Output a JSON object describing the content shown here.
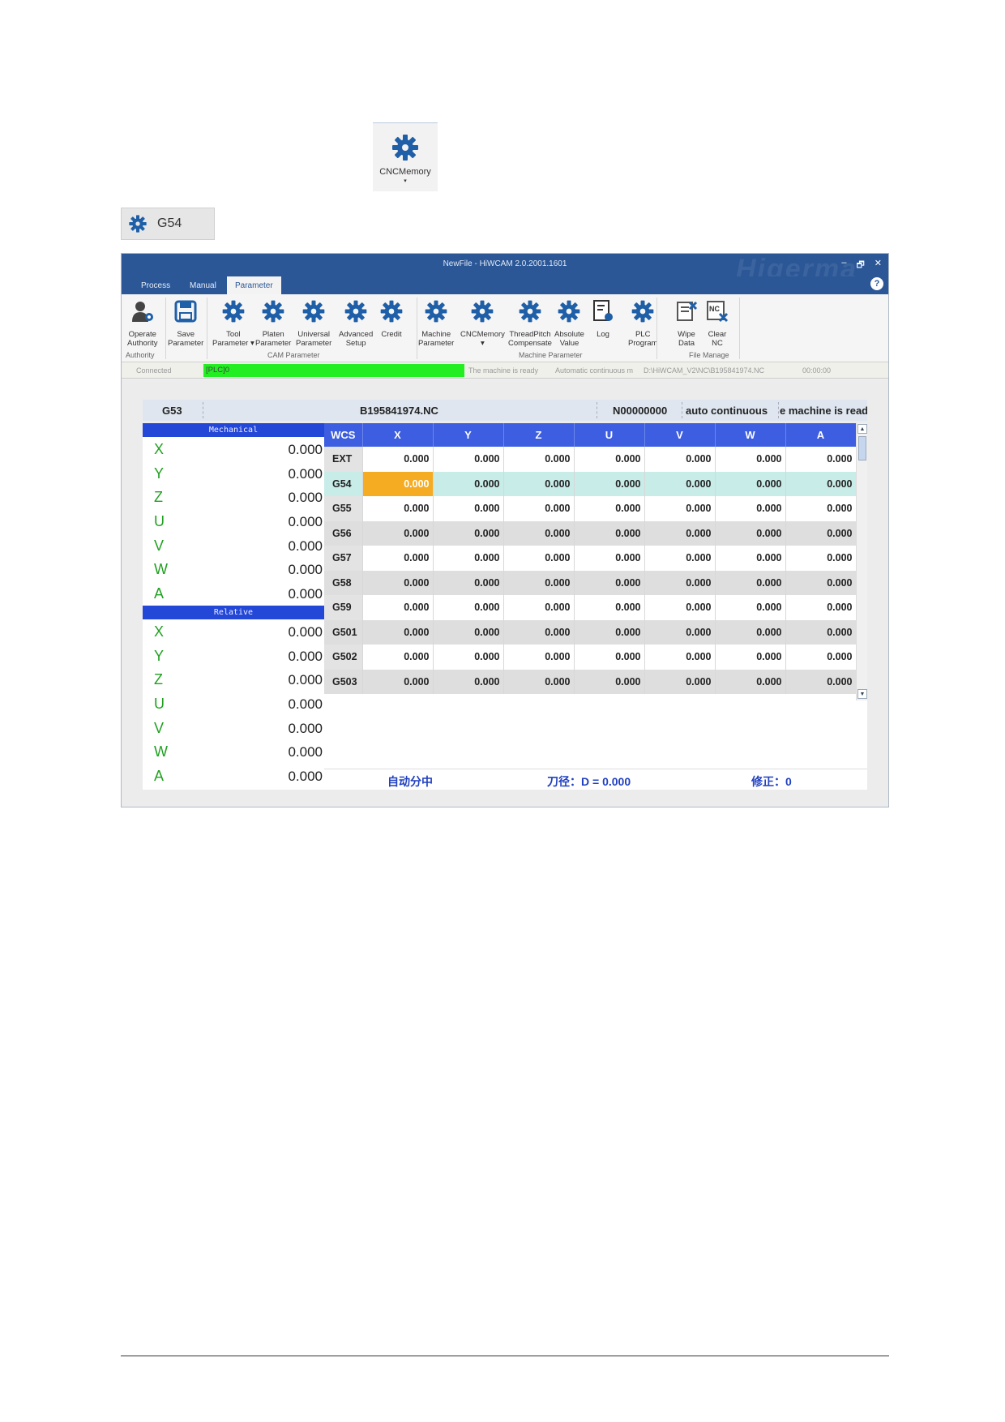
{
  "snippets": {
    "cnc_memory_label": "CNCMemory",
    "cnc_memory_arrow": "▾",
    "g54_label": "G54"
  },
  "window": {
    "title": "NewFile - HiWCAM 2.0.2001.1601",
    "watermark": "Higerma",
    "controls": [
      "–",
      "🗗",
      "✕"
    ],
    "help": "?"
  },
  "tabs": [
    "Process",
    "Manual",
    "Parameter"
  ],
  "active_tab": "Parameter",
  "ribbon": {
    "buttons": [
      {
        "label": "Operate\nAuthority",
        "icon": "user-gear-icon"
      },
      {
        "label": "Save\nParameter",
        "icon": "save-icon"
      },
      {
        "label": "Tool\nParameter ▾",
        "icon": "gear-icon"
      },
      {
        "label": "Platen\nParameter",
        "icon": "gear-icon"
      },
      {
        "label": "Universal\nParameter",
        "icon": "gear-icon"
      },
      {
        "label": "Advanced\nSetup",
        "icon": "gear-icon"
      },
      {
        "label": "Credit",
        "icon": "gear-icon"
      },
      {
        "label": "Machine\nParameter",
        "icon": "gear-icon"
      },
      {
        "label": "CNCMemory\n▾",
        "icon": "gear-icon"
      },
      {
        "label": "ThreadPitch\nCompensate",
        "icon": "gear-icon"
      },
      {
        "label": "Absolute\nValue",
        "icon": "gear-icon"
      },
      {
        "label": "Log",
        "icon": "log-icon"
      },
      {
        "label": "PLC\nProgram",
        "icon": "gear-icon"
      },
      {
        "label": "Wipe\nData",
        "icon": "wipe-data-icon"
      },
      {
        "label": "Clear\nNC",
        "icon": "clear-nc-icon"
      }
    ],
    "groups": [
      "Authority",
      "CAM Parameter",
      "Machine Parameter",
      "File Manage"
    ]
  },
  "status": {
    "connected": "Connected",
    "plc": "[PLC]0",
    "ready": "The machine is ready",
    "auto": "Automatic continuous m",
    "path": "D:\\HiWCAM_V2\\NC\\B195841974.NC",
    "time": "00:00:00",
    "colors": {
      "plc_bar": "#22ee22",
      "accent": "#2b5797",
      "header": "#3d5ee0",
      "current_cell": "#f5ac22",
      "selected_row": "#c8ece8"
    }
  },
  "infobar": {
    "coord": "G53",
    "file": "B195841974.NC",
    "line": "N00000000",
    "mode": "auto continuous",
    "state": "e machine is read"
  },
  "mechanical": {
    "title": "Mechanical",
    "rows": [
      {
        "axis": "X",
        "value": "0.000"
      },
      {
        "axis": "Y",
        "value": "0.000"
      },
      {
        "axis": "Z",
        "value": "0.000"
      },
      {
        "axis": "U",
        "value": "0.000"
      },
      {
        "axis": "V",
        "value": "0.000"
      },
      {
        "axis": "W",
        "value": "0.000"
      },
      {
        "axis": "A",
        "value": "0.000"
      }
    ]
  },
  "relative": {
    "title": "Relative",
    "rows": [
      {
        "axis": "X",
        "value": "0.000"
      },
      {
        "axis": "Y",
        "value": "0.000"
      },
      {
        "axis": "Z",
        "value": "0.000"
      },
      {
        "axis": "U",
        "value": "0.000"
      },
      {
        "axis": "V",
        "value": "0.000"
      },
      {
        "axis": "W",
        "value": "0.000"
      },
      {
        "axis": "A",
        "value": "0.000"
      }
    ]
  },
  "table": {
    "headers": [
      "WCS",
      "X",
      "Y",
      "Z",
      "U",
      "V",
      "W",
      "A"
    ],
    "rows": [
      [
        "EXT",
        "0.000",
        "0.000",
        "0.000",
        "0.000",
        "0.000",
        "0.000",
        "0.000"
      ],
      [
        "G54",
        "0.000",
        "0.000",
        "0.000",
        "0.000",
        "0.000",
        "0.000",
        "0.000"
      ],
      [
        "G55",
        "0.000",
        "0.000",
        "0.000",
        "0.000",
        "0.000",
        "0.000",
        "0.000"
      ],
      [
        "G56",
        "0.000",
        "0.000",
        "0.000",
        "0.000",
        "0.000",
        "0.000",
        "0.000"
      ],
      [
        "G57",
        "0.000",
        "0.000",
        "0.000",
        "0.000",
        "0.000",
        "0.000",
        "0.000"
      ],
      [
        "G58",
        "0.000",
        "0.000",
        "0.000",
        "0.000",
        "0.000",
        "0.000",
        "0.000"
      ],
      [
        "G59",
        "0.000",
        "0.000",
        "0.000",
        "0.000",
        "0.000",
        "0.000",
        "0.000"
      ],
      [
        "G501",
        "0.000",
        "0.000",
        "0.000",
        "0.000",
        "0.000",
        "0.000",
        "0.000"
      ],
      [
        "G502",
        "0.000",
        "0.000",
        "0.000",
        "0.000",
        "0.000",
        "0.000",
        "0.000"
      ],
      [
        "G503",
        "0.000",
        "0.000",
        "0.000",
        "0.000",
        "0.000",
        "0.000",
        "0.000"
      ]
    ],
    "selected_row": 1,
    "current_col": 1
  },
  "footer": {
    "mode": "自动分中",
    "tool_radius": "刀径：D = 0.000",
    "correction": "修正：0"
  }
}
